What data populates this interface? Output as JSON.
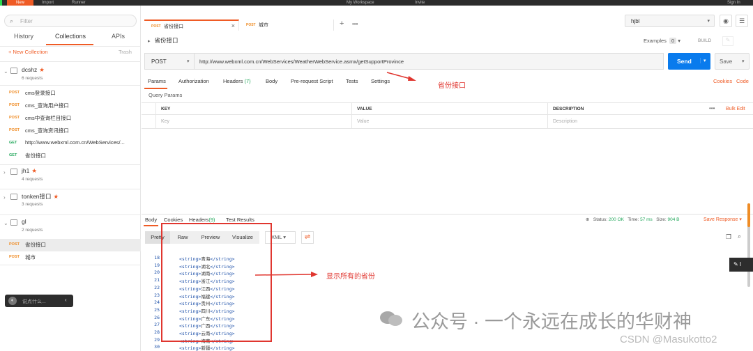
{
  "topbar": {
    "new_label": "New",
    "import_label": "Import",
    "runner_label": "Runner",
    "workspace_label": "My Workspace",
    "invite_label": "Invite",
    "signin_label": "Sign In"
  },
  "sidebar": {
    "filter_placeholder": "Filter",
    "tabs": [
      "History",
      "Collections",
      "APIs"
    ],
    "new_collection": "+ New Collection",
    "trash": "Trash",
    "collections": [
      {
        "name": "dcshz",
        "count": "6 requests",
        "requests": [
          {
            "method": "POST",
            "name": "cms登录接口"
          },
          {
            "method": "POST",
            "name": "cms_查询用户接口"
          },
          {
            "method": "POST",
            "name": "cms中查询栏目接口"
          },
          {
            "method": "POST",
            "name": "cms_查询资讯接口"
          },
          {
            "method": "GET",
            "name": "http://www.webxml.com.cn/WebServices/..."
          },
          {
            "method": "GET",
            "name": "省份接口"
          }
        ]
      },
      {
        "name": "jh1",
        "count": "4 requests",
        "requests": []
      },
      {
        "name": "tonken接口",
        "count": "3 requests",
        "requests": []
      },
      {
        "name": "gl",
        "count": "2 requests",
        "requests": [
          {
            "method": "POST",
            "name": "省份接口"
          },
          {
            "method": "POST",
            "name": "城市"
          }
        ]
      }
    ],
    "chat_placeholder": "说点什么..."
  },
  "tabs": [
    {
      "method": "POST",
      "name": "省份接口"
    },
    {
      "method": "POST",
      "name": "城市"
    }
  ],
  "environment": "hjbl",
  "request": {
    "title": "省份接口",
    "examples_label": "Examples",
    "examples_count": "0",
    "build_label": "BUILD",
    "method": "POST",
    "url": "http://www.webxml.com.cn/WebServices/WeatherWebService.asmx/getSupportProvince",
    "send_label": "Send",
    "save_label": "Save",
    "tabs": [
      "Params",
      "Authorization",
      "Headers",
      "Body",
      "Pre-request Script",
      "Tests",
      "Settings"
    ],
    "headers_count": "(7)",
    "cookies_label": "Cookies",
    "code_label": "Code",
    "query_params_label": "Query Params",
    "columns": [
      "KEY",
      "VALUE",
      "DESCRIPTION"
    ],
    "placeholders": [
      "Key",
      "Value",
      "Description"
    ],
    "bulk_edit": "Bulk Edit"
  },
  "response": {
    "tabs": [
      "Body",
      "Cookies",
      "Headers",
      "Test Results"
    ],
    "headers_count": "(9)",
    "status_label": "Status:",
    "status_value": "200 OK",
    "time_label": "Time:",
    "time_value": "57 ms",
    "size_label": "Size:",
    "size_value": "904 B",
    "save_response": "Save Response",
    "format_buttons": [
      "Pretty",
      "Raw",
      "Preview",
      "Visualize"
    ],
    "format": "XML",
    "lines": [
      {
        "n": "18",
        "v": "青海"
      },
      {
        "n": "19",
        "v": "湖北"
      },
      {
        "n": "20",
        "v": "湖南"
      },
      {
        "n": "21",
        "v": "浙江"
      },
      {
        "n": "22",
        "v": "江西"
      },
      {
        "n": "23",
        "v": "福建"
      },
      {
        "n": "24",
        "v": "贵州"
      },
      {
        "n": "25",
        "v": "四川"
      },
      {
        "n": "26",
        "v": "广东"
      },
      {
        "n": "27",
        "v": "广西"
      },
      {
        "n": "28",
        "v": "云南"
      },
      {
        "n": "29",
        "v": "海南"
      },
      {
        "n": "30",
        "v": "新疆"
      }
    ]
  },
  "annotations": {
    "top": "省份接口",
    "middle": "显示所有的省份"
  },
  "watermark": "公众号 · 一个永远在成长的华财神",
  "csdn": "CSDN @Masukotto2"
}
